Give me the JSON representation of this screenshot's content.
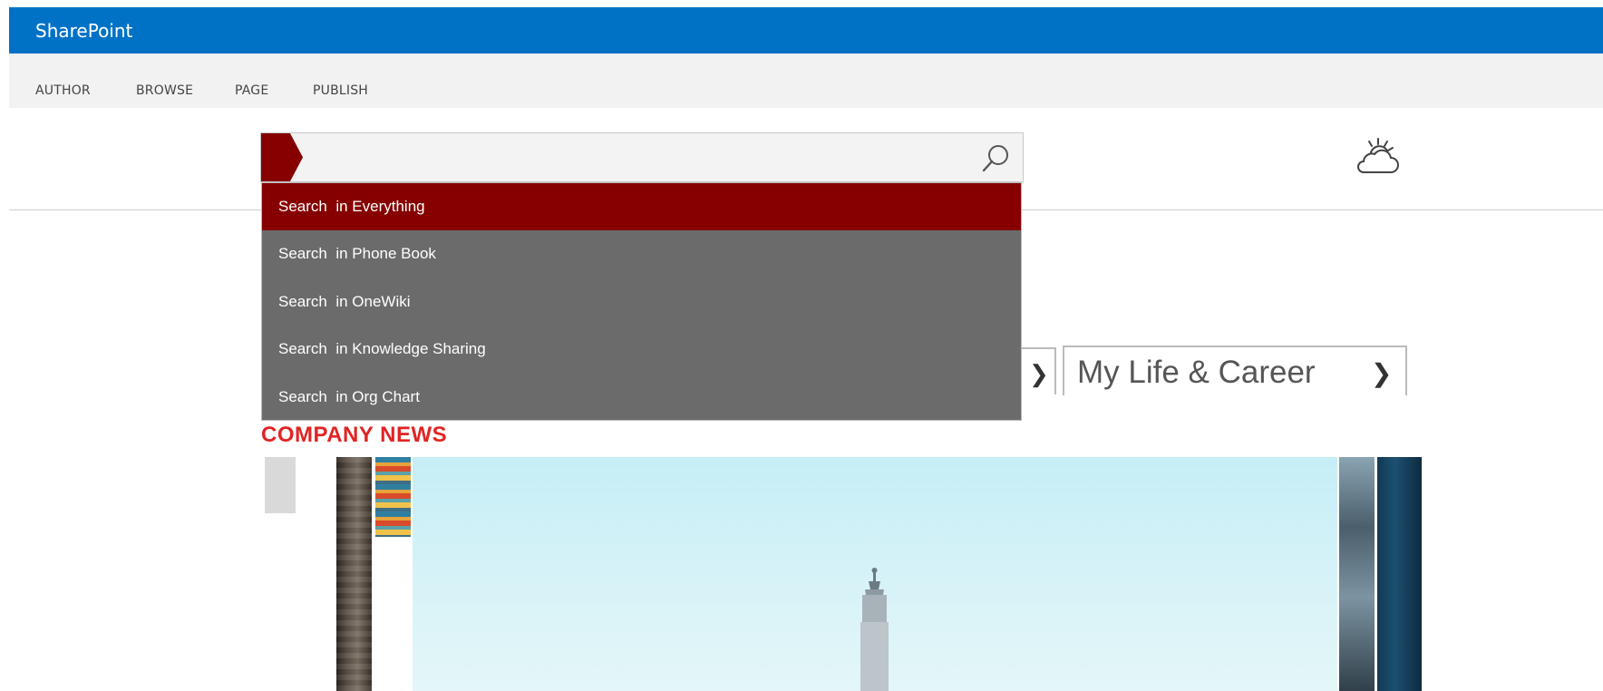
{
  "suite_bar": {
    "brand": "SharePoint"
  },
  "ribbon": {
    "tabs": [
      {
        "label": "AUTHOR"
      },
      {
        "label": "BROWSE"
      },
      {
        "label": "PAGE"
      },
      {
        "label": "PUBLISH"
      }
    ]
  },
  "search": {
    "value": "",
    "icon": "magnifier-icon",
    "dropdown": {
      "items": [
        {
          "prefix": "Search",
          "scope": "in Everything",
          "selected": true
        },
        {
          "prefix": "Search",
          "scope": "in Phone Book",
          "selected": false
        },
        {
          "prefix": "Search",
          "scope": "in OneWiki",
          "selected": false
        },
        {
          "prefix": "Search",
          "scope": "in Knowledge Sharing",
          "selected": false
        },
        {
          "prefix": "Search",
          "scope": "in Org Chart",
          "selected": false
        }
      ]
    }
  },
  "weather": {
    "icon": "weather-cloud-sun-icon"
  },
  "tiles": [
    {
      "label": "My Life & Career",
      "chevron": "❯"
    }
  ],
  "tile_arrow": {
    "chevron": "❯"
  },
  "news": {
    "heading": "COMPANY NEWS"
  },
  "colors": {
    "suite_bar": "#0072c6",
    "accent": "#860000",
    "dropdown_bg": "#6b6b6b",
    "news_heading": "#e02424"
  }
}
